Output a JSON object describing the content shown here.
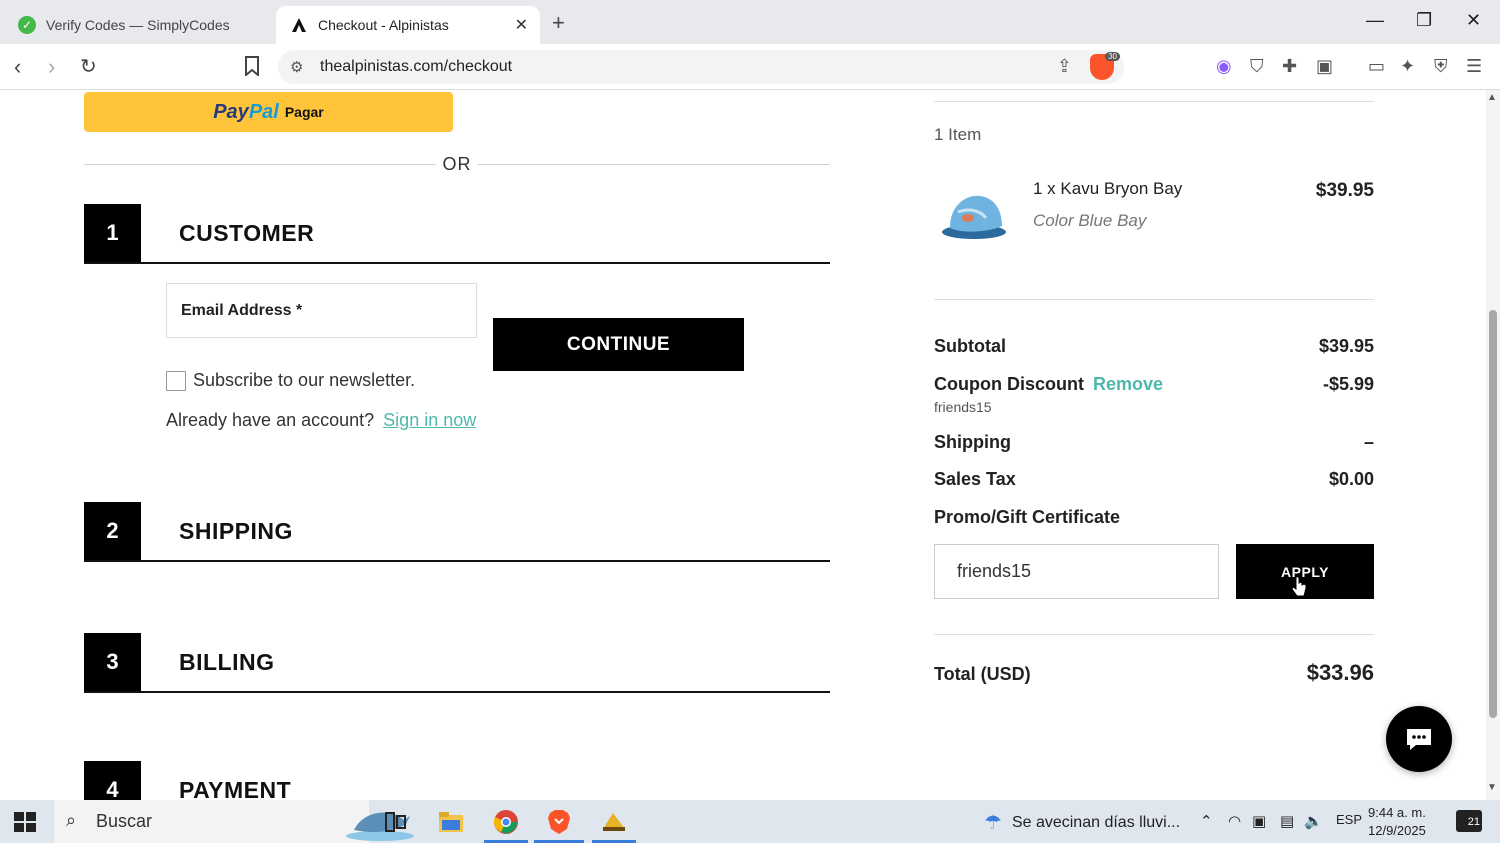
{
  "browser": {
    "tabs": [
      {
        "title": "Verify Codes — SimplyCodes",
        "active": false
      },
      {
        "title": "Checkout - Alpinistas",
        "active": true
      }
    ],
    "url": "thealpinistas.com/checkout",
    "brave_badge": "30"
  },
  "checkout": {
    "paypal": {
      "brand_pay": "Pay",
      "brand_pal": "Pal",
      "label": "Pagar"
    },
    "or_text": "OR",
    "steps": [
      {
        "number": "1",
        "title": "CUSTOMER"
      },
      {
        "number": "2",
        "title": "SHIPPING"
      },
      {
        "number": "3",
        "title": "BILLING"
      },
      {
        "number": "4",
        "title": "PAYMENT"
      }
    ],
    "customer": {
      "email_label": "Email Address *",
      "continue_label": "CONTINUE",
      "newsletter_label": "Subscribe to our newsletter.",
      "account_prompt": "Already have an account?",
      "signin_link": "Sign in now"
    }
  },
  "summary": {
    "item_count": "1 Item",
    "item": {
      "name": "1 x Kavu Bryon Bay",
      "variant": "Color Blue Bay",
      "price": "$39.95"
    },
    "subtotal_label": "Subtotal",
    "subtotal_value": "$39.95",
    "coupon_label": "Coupon Discount",
    "coupon_remove": "Remove",
    "coupon_value": "-$5.99",
    "coupon_code": "friends15",
    "shipping_label": "Shipping",
    "shipping_value": "–",
    "tax_label": "Sales Tax",
    "tax_value": "$0.00",
    "promo_label": "Promo/Gift Certificate",
    "promo_input_value": "friends15",
    "apply_label": "APPLY",
    "total_label": "Total (USD)",
    "total_value": "$33.96"
  },
  "taskbar": {
    "search_placeholder": "Buscar",
    "weather_text": "Se avecinan días lluvi...",
    "language": "ESP",
    "time": "9:44 a. m.",
    "date": "12/9/2025",
    "notifications": "21"
  },
  "colors": {
    "link_teal": "#4fb8ac",
    "paypal_yellow": "#ffc439",
    "primary_black": "#000000"
  }
}
